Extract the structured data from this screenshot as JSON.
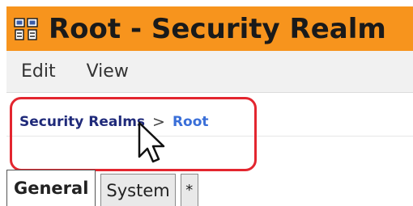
{
  "window": {
    "title": "Root - Security Realm",
    "icon": "server-cluster-icon",
    "titlebar_color": "#f7941d"
  },
  "menu": {
    "items": [
      {
        "label": "Edit"
      },
      {
        "label": "View"
      }
    ]
  },
  "breadcrumb": {
    "parent_label": "Security Realms",
    "separator": ">",
    "current_label": "Root",
    "link_color": "#1f2a7a",
    "current_color": "#3a6fd8"
  },
  "annotation": {
    "ring_color": "#e3262f"
  },
  "tabs": [
    {
      "label": "General",
      "active": true
    },
    {
      "label": "System",
      "active": false
    },
    {
      "label": "*",
      "active": false
    }
  ]
}
